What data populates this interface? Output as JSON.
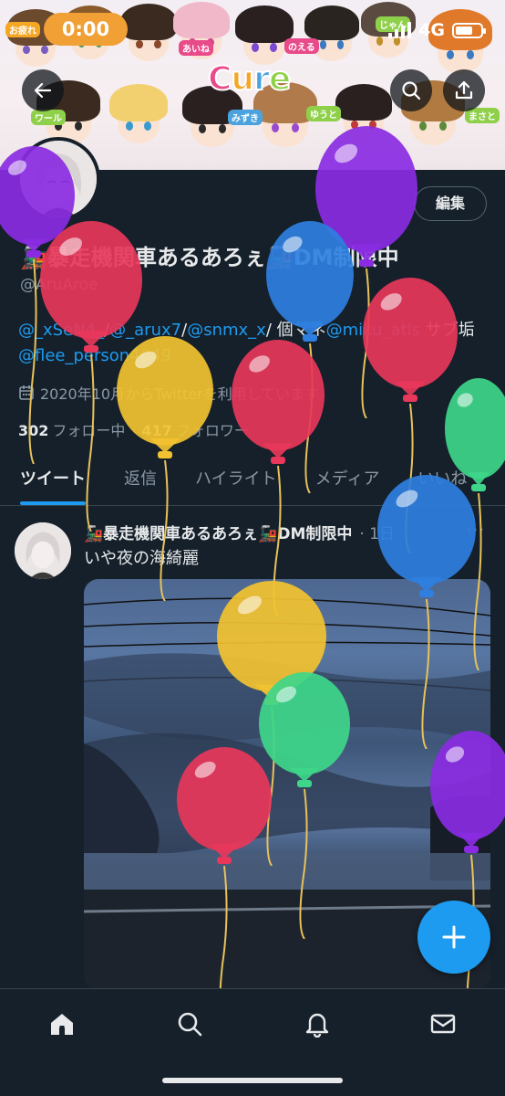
{
  "status_bar": {
    "time": "0:00",
    "network": "4G",
    "battery_level": 0.7
  },
  "banner": {
    "logo_letters": [
      "C",
      "u",
      "r",
      "e"
    ],
    "logo_colors": [
      "#e84a8a",
      "#f5a623",
      "#4aa3df",
      "#8fd04a"
    ],
    "tags": [
      "お疲れ",
      "じゃん",
      "のえる",
      "あいね",
      "ワール",
      "ゆうと",
      "みずき",
      "まさと"
    ]
  },
  "header_actions": {
    "back_icon": "arrow-left-icon",
    "search_icon": "search-icon",
    "share_icon": "share-icon"
  },
  "profile": {
    "edit_label": "編集",
    "display_name": "🚂暴走機関車あるあろぇ🚂DM制限中",
    "handle": "@AruAroe",
    "bio_parts": [
      {
        "text": "@_xSeN4_",
        "link": true
      },
      {
        "text": "/",
        "link": false
      },
      {
        "text": "@_arux7",
        "link": true
      },
      {
        "text": "/",
        "link": false
      },
      {
        "text": "@snmx_x",
        "link": true
      },
      {
        "text": "/ 個マネ",
        "link": false
      },
      {
        "text": "@miku_atls",
        "link": true
      },
      {
        "text": " サブ垢",
        "link": false
      },
      {
        "text": "@flee_person4649",
        "link": true
      }
    ],
    "joined": "2020年10月からTwitterを利用しています",
    "following_count": "302",
    "following_label": "フォロー中",
    "followers_count": "417",
    "followers_label": "フォロワー"
  },
  "tabs": [
    {
      "label": "ツイート",
      "active": true
    },
    {
      "label": "返信",
      "active": false
    },
    {
      "label": "ハイライト",
      "active": false
    },
    {
      "label": "メディア",
      "active": false
    },
    {
      "label": "いいね",
      "active": false
    }
  ],
  "tweet": {
    "author": "🚂暴走機関車あるあろぇ🚂DM制限中",
    "time": "· 1日",
    "more": "···",
    "text": "いや夜の海綺麗"
  },
  "fab": {
    "icon": "plus-icon"
  },
  "bottom_nav": [
    "home-icon",
    "search-icon",
    "bell-icon",
    "mail-icon"
  ],
  "balloon_colors": {
    "purple": "#8a2be2",
    "red": "#e8375a",
    "blue": "#2f7fe0",
    "yellow": "#f2c230",
    "green": "#3ed68a"
  }
}
